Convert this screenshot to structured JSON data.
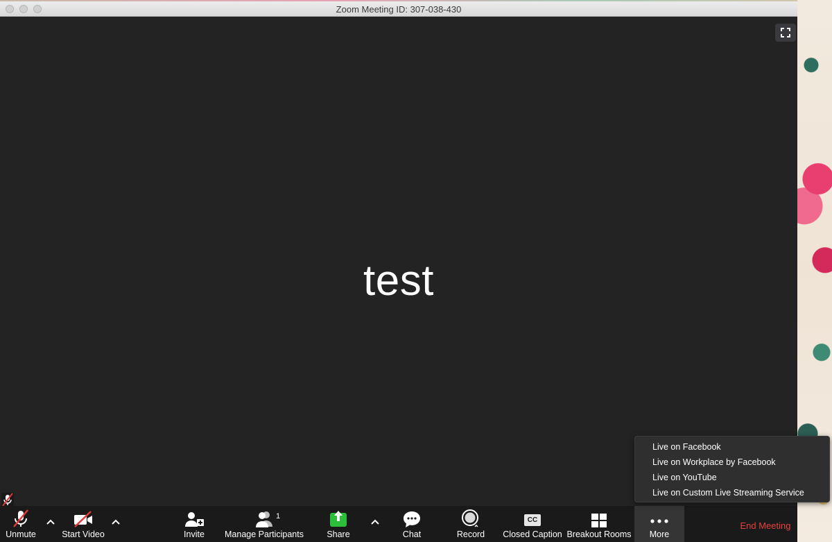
{
  "window": {
    "title": "Zoom Meeting ID: 307-038-430"
  },
  "video": {
    "participant_name": "test"
  },
  "toolbar": {
    "unmute_label": "Unmute",
    "start_video_label": "Start Video",
    "invite_label": "Invite",
    "manage_participants_label": "Manage Participants",
    "participant_count": "1",
    "share_label": "Share",
    "chat_label": "Chat",
    "record_label": "Record",
    "closed_caption_label": "Closed Caption",
    "cc_icon_text": "CC",
    "breakout_rooms_label": "Breakout Rooms",
    "more_label": "More",
    "end_meeting_label": "End Meeting"
  },
  "more_menu": {
    "items": [
      {
        "label": "Live on Facebook"
      },
      {
        "label": "Live on Workplace by Facebook"
      },
      {
        "label": "Live on YouTube"
      },
      {
        "label": "Live on Custom Live Streaming Service"
      }
    ]
  },
  "colors": {
    "background": "#232323",
    "toolbar": "#1a1a1a",
    "end_meeting": "#e8413b",
    "share_green": "#2dbe3c",
    "muted_red": "#e03a3a"
  },
  "icons": {
    "unmute": "muted-mic-icon",
    "start_video": "video-off-icon",
    "invite": "add-person-icon",
    "participants": "participants-icon",
    "share": "share-screen-icon",
    "chat": "chat-bubble-icon",
    "record": "record-icon",
    "closed_caption": "cc-icon",
    "breakout": "grid-icon",
    "more": "ellipsis-icon",
    "fullscreen": "fullscreen-icon"
  }
}
